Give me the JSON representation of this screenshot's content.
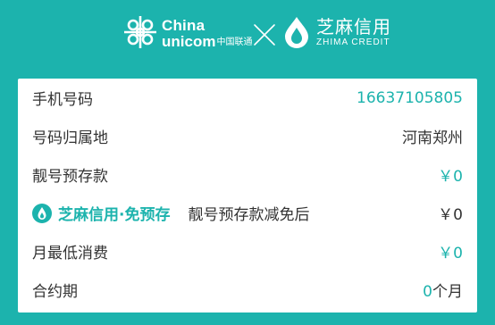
{
  "header": {
    "unicom_en_line1": "China",
    "unicom_en_line2": "unicom",
    "unicom_cn": "中国联通",
    "zhima_cn": "芝麻信用",
    "zhima_en": "ZHIMA CREDIT"
  },
  "rows": [
    {
      "label": "手机号码",
      "value": "16637105805",
      "value_color": "teal"
    },
    {
      "label": "号码归属地",
      "value": "河南郑州",
      "value_color": "dark"
    },
    {
      "label": "靓号预存款",
      "value": "￥0",
      "value_color": "teal"
    },
    {
      "badge": "芝麻信用·免预存",
      "label": "靓号预存款减免后",
      "value": "￥0",
      "value_color": "dark"
    },
    {
      "label": "月最低消费",
      "value": "￥0",
      "value_color": "teal"
    },
    {
      "label": "合约期",
      "value_number": "0",
      "value_unit": "个月"
    }
  ],
  "colors": {
    "accent": "#1cb3ad",
    "card_bg": "#ffffff",
    "text": "#333333"
  },
  "icons": [
    "china-unicom-logo-icon",
    "cross-icon",
    "zhima-credit-logo-icon",
    "zhima-drop-icon"
  ]
}
